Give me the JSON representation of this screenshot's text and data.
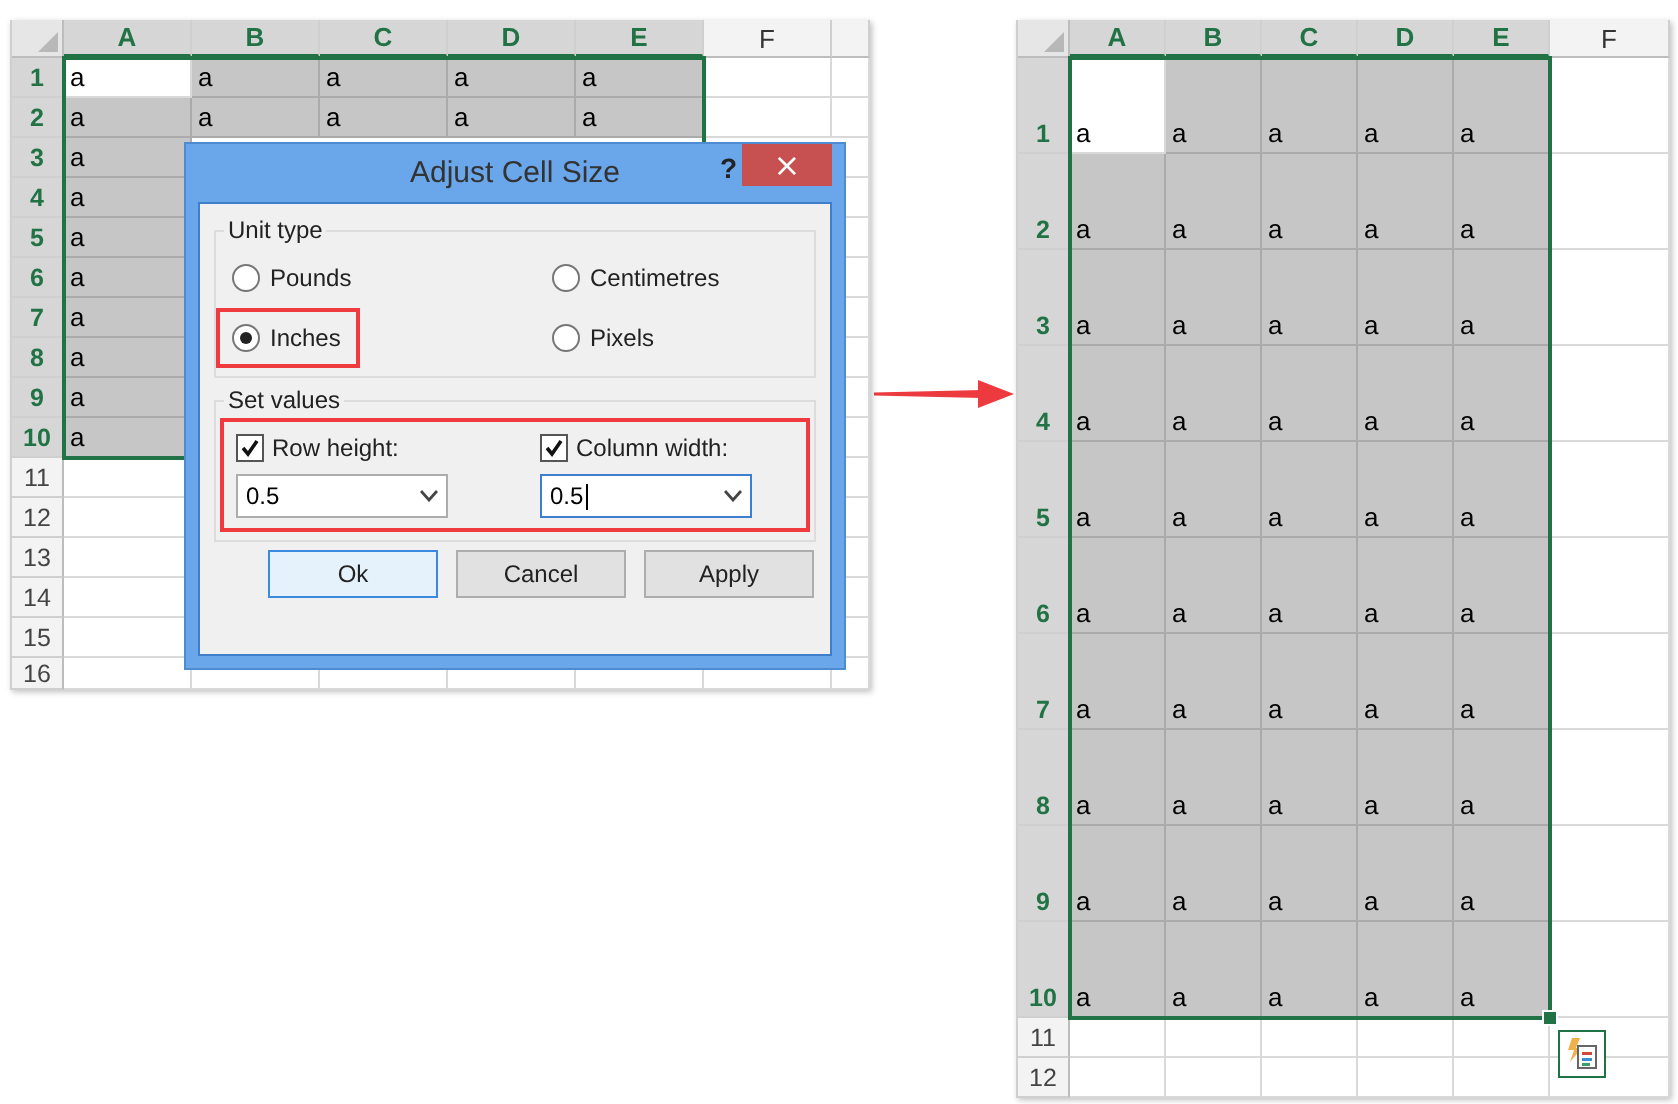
{
  "sheets": [
    {
      "kind": "original",
      "columns": [
        {
          "label": "A",
          "selected": true
        },
        {
          "label": "B",
          "selected": true
        },
        {
          "label": "C",
          "selected": true
        },
        {
          "label": "D",
          "selected": true
        },
        {
          "label": "E",
          "selected": true
        },
        {
          "label": "F",
          "selected": false
        }
      ],
      "rows": [
        {
          "header": "1",
          "selected": true,
          "cells": [
            {
              "text": "a",
              "active": true
            },
            {
              "text": "a",
              "active": false
            },
            {
              "text": "a",
              "active": false
            },
            {
              "text": "a",
              "active": false
            },
            {
              "text": "a",
              "active": false
            }
          ]
        },
        {
          "header": "2",
          "selected": true,
          "cells": [
            {
              "text": "a",
              "active": false
            },
            {
              "text": "a",
              "active": false
            },
            {
              "text": "a",
              "active": false
            },
            {
              "text": "a",
              "active": false
            },
            {
              "text": "a",
              "active": false
            }
          ]
        },
        {
          "header": "3",
          "selected": true,
          "cells": [
            {
              "text": "a",
              "active": false
            }
          ]
        },
        {
          "header": "4",
          "selected": true,
          "cells": [
            {
              "text": "a",
              "active": false
            }
          ]
        },
        {
          "header": "5",
          "selected": true,
          "cells": [
            {
              "text": "a",
              "active": false
            }
          ]
        },
        {
          "header": "6",
          "selected": true,
          "cells": [
            {
              "text": "a",
              "active": false
            }
          ]
        },
        {
          "header": "7",
          "selected": true,
          "cells": [
            {
              "text": "a",
              "active": false
            }
          ]
        },
        {
          "header": "8",
          "selected": true,
          "cells": [
            {
              "text": "a",
              "active": false
            }
          ]
        },
        {
          "header": "9",
          "selected": true,
          "cells": [
            {
              "text": "a",
              "active": false
            }
          ]
        },
        {
          "header": "10",
          "selected": true,
          "cells": [
            {
              "text": "a",
              "active": false
            }
          ]
        },
        {
          "header": "11",
          "selected": false
        },
        {
          "header": "12",
          "selected": false
        },
        {
          "header": "13",
          "selected": false
        },
        {
          "header": "14",
          "selected": false
        },
        {
          "header": "15",
          "selected": false
        },
        {
          "header": "16",
          "selected": false
        }
      ]
    },
    {
      "kind": "resized",
      "columns": [
        {
          "label": "A",
          "selected": true
        },
        {
          "label": "B",
          "selected": true
        },
        {
          "label": "C",
          "selected": true
        },
        {
          "label": "D",
          "selected": true
        },
        {
          "label": "E",
          "selected": true
        },
        {
          "label": "F",
          "selected": false
        }
      ],
      "rows": [
        {
          "header": "1",
          "selected": true,
          "cells": [
            {
              "text": "a",
              "active": true
            },
            {
              "text": "a",
              "active": false
            },
            {
              "text": "a",
              "active": false
            },
            {
              "text": "a",
              "active": false
            },
            {
              "text": "a",
              "active": false
            }
          ]
        },
        {
          "header": "2",
          "selected": true,
          "cells": [
            {
              "text": "a",
              "active": false
            },
            {
              "text": "a",
              "active": false
            },
            {
              "text": "a",
              "active": false
            },
            {
              "text": "a",
              "active": false
            },
            {
              "text": "a",
              "active": false
            }
          ]
        },
        {
          "header": "3",
          "selected": true,
          "cells": [
            {
              "text": "a",
              "active": false
            },
            {
              "text": "a",
              "active": false
            },
            {
              "text": "a",
              "active": false
            },
            {
              "text": "a",
              "active": false
            },
            {
              "text": "a",
              "active": false
            }
          ]
        },
        {
          "header": "4",
          "selected": true,
          "cells": [
            {
              "text": "a",
              "active": false
            },
            {
              "text": "a",
              "active": false
            },
            {
              "text": "a",
              "active": false
            },
            {
              "text": "a",
              "active": false
            },
            {
              "text": "a",
              "active": false
            }
          ]
        },
        {
          "header": "5",
          "selected": true,
          "cells": [
            {
              "text": "a",
              "active": false
            },
            {
              "text": "a",
              "active": false
            },
            {
              "text": "a",
              "active": false
            },
            {
              "text": "a",
              "active": false
            },
            {
              "text": "a",
              "active": false
            }
          ]
        },
        {
          "header": "6",
          "selected": true,
          "cells": [
            {
              "text": "a",
              "active": false
            },
            {
              "text": "a",
              "active": false
            },
            {
              "text": "a",
              "active": false
            },
            {
              "text": "a",
              "active": false
            },
            {
              "text": "a",
              "active": false
            }
          ]
        },
        {
          "header": "7",
          "selected": true,
          "cells": [
            {
              "text": "a",
              "active": false
            },
            {
              "text": "a",
              "active": false
            },
            {
              "text": "a",
              "active": false
            },
            {
              "text": "a",
              "active": false
            },
            {
              "text": "a",
              "active": false
            }
          ]
        },
        {
          "header": "8",
          "selected": true,
          "cells": [
            {
              "text": "a",
              "active": false
            },
            {
              "text": "a",
              "active": false
            },
            {
              "text": "a",
              "active": false
            },
            {
              "text": "a",
              "active": false
            },
            {
              "text": "a",
              "active": false
            }
          ]
        },
        {
          "header": "9",
          "selected": true,
          "cells": [
            {
              "text": "a",
              "active": false
            },
            {
              "text": "a",
              "active": false
            },
            {
              "text": "a",
              "active": false
            },
            {
              "text": "a",
              "active": false
            },
            {
              "text": "a",
              "active": false
            }
          ]
        },
        {
          "header": "10",
          "selected": true,
          "cells": [
            {
              "text": "a",
              "active": false
            },
            {
              "text": "a",
              "active": false
            },
            {
              "text": "a",
              "active": false
            },
            {
              "text": "a",
              "active": false
            },
            {
              "text": "a",
              "active": false
            }
          ]
        },
        {
          "header": "11",
          "selected": false
        },
        {
          "header": "12",
          "selected": false
        }
      ]
    }
  ],
  "dialog": {
    "title": "Adjust Cell Size",
    "help": "?",
    "close": "×",
    "unit_group": {
      "label": "Unit type",
      "options": [
        {
          "label": "Pounds",
          "selected": false,
          "highlighted": false
        },
        {
          "label": "Centimetres",
          "selected": false,
          "highlighted": false
        },
        {
          "label": "Inches",
          "selected": true,
          "highlighted": true
        },
        {
          "label": "Pixels",
          "selected": false,
          "highlighted": false
        }
      ]
    },
    "values_group": {
      "label": "Set values",
      "highlighted": true,
      "fields": [
        {
          "label": "Row height:",
          "checked": true,
          "value": "0.5",
          "focused": false
        },
        {
          "label": "Column width:",
          "checked": true,
          "value": "0.5",
          "focused": true
        }
      ]
    },
    "buttons": [
      {
        "label": "Ok",
        "default": true
      },
      {
        "label": "Cancel",
        "default": false
      },
      {
        "label": "Apply",
        "default": false
      }
    ]
  }
}
